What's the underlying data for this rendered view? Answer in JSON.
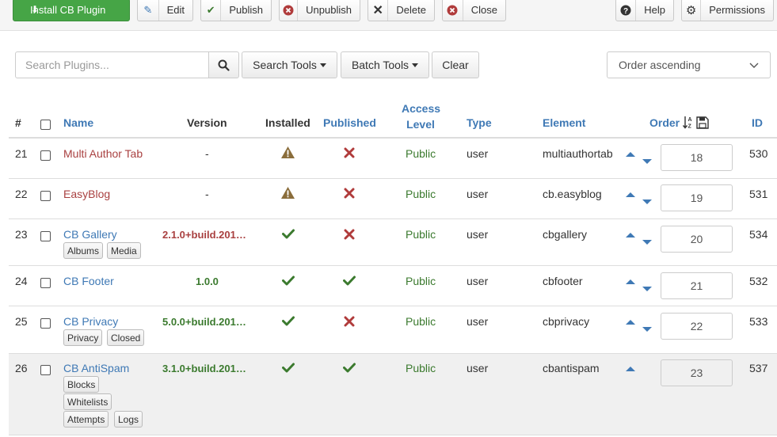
{
  "toolbar": {
    "install_label": "Install CB Plugin",
    "edit_label": "Edit",
    "publish_label": "Publish",
    "unpublish_label": "Unpublish",
    "delete_label": "Delete",
    "close_label": "Close",
    "help_label": "Help",
    "permissions_label": "Permissions"
  },
  "filters": {
    "search_placeholder": "Search Plugins...",
    "search_tools_label": "Search Tools",
    "batch_tools_label": "Batch Tools",
    "clear_label": "Clear",
    "order_value": "Order ascending"
  },
  "table": {
    "headers": {
      "num": "#",
      "name": "Name",
      "version": "Version",
      "installed": "Installed",
      "published": "Published",
      "access_line1": "Access",
      "access_line2": "Level",
      "type": "Type",
      "element": "Element",
      "order": "Order",
      "id": "ID"
    },
    "rows": [
      {
        "num": "21",
        "name": "Multi Author Tab",
        "version": "-",
        "installed": "warning",
        "published": "no",
        "access": "Public",
        "type": "user",
        "element": "multiauthortab",
        "order": "18",
        "id": "530",
        "tags": []
      },
      {
        "num": "22",
        "name": "EasyBlog",
        "version": "-",
        "installed": "warning",
        "published": "no",
        "access": "Public",
        "type": "user",
        "element": "cb.easyblog",
        "order": "19",
        "id": "531",
        "tags": []
      },
      {
        "num": "23",
        "name": "CB Gallery",
        "version": "2.1.0+build.201…",
        "installed": "yes",
        "published": "no",
        "access": "Public",
        "type": "user",
        "element": "cbgallery",
        "order": "20",
        "id": "534",
        "tags": [
          "Albums",
          "Media"
        ]
      },
      {
        "num": "24",
        "name": "CB Footer",
        "version": "1.0.0",
        "installed": "yes",
        "published": "yes",
        "access": "Public",
        "type": "user",
        "element": "cbfooter",
        "order": "21",
        "id": "532",
        "tags": []
      },
      {
        "num": "25",
        "name": "CB Privacy",
        "version": "5.0.0+build.201…",
        "installed": "yes",
        "published": "no",
        "access": "Public",
        "type": "user",
        "element": "cbprivacy",
        "order": "22",
        "id": "533",
        "tags": [
          "Privacy",
          "Closed"
        ]
      },
      {
        "num": "26",
        "name": "CB AntiSpam",
        "version": "3.1.0+build.201…",
        "installed": "yes",
        "published": "yes",
        "access": "Public",
        "type": "user",
        "element": "cbantispam",
        "order": "23",
        "id": "537",
        "tags": [
          "Blocks",
          "Whitelists",
          "Attempts",
          "Logs"
        ]
      }
    ]
  },
  "colors": {
    "install_green": "#46a546",
    "link_blue": "#3f79b5",
    "red_name": "#a94040",
    "check_green": "#3b7a2e",
    "cross_red": "#b03b3b",
    "warning_brown": "#8a6d3b"
  }
}
